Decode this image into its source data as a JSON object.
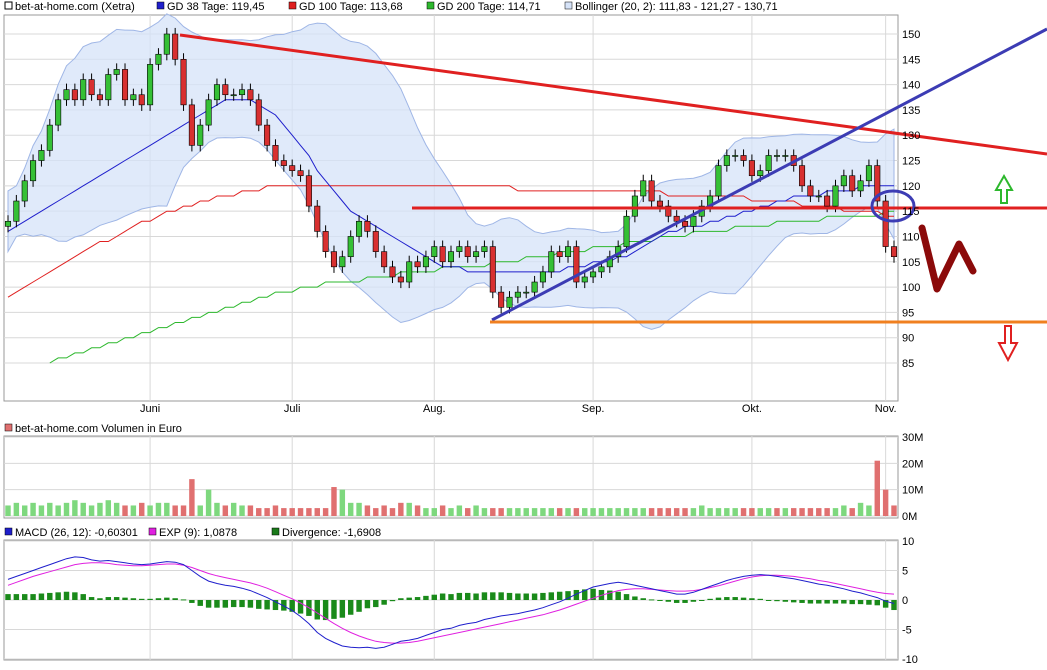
{
  "chart_data": [
    {
      "type": "candlestick",
      "legend": [
        {
          "label": "bet-at-home.com (Xetra)",
          "color": "#000000"
        },
        {
          "label": "GD 38 Tage: 119,45",
          "color": "#1f1fcc"
        },
        {
          "label": "GD 100 Tage: 113,68",
          "color": "#e02020"
        },
        {
          "label": "GD 200 Tage: 114,71",
          "color": "#2db82d"
        },
        {
          "label": "Bollinger (20, 2): 111,83 - 121,27 - 130,71",
          "color": "#9fb6e6"
        }
      ],
      "x_tick_labels": [
        "Juni",
        "Juli",
        "Aug.",
        "Sep.",
        "Okt.",
        "Nov."
      ],
      "y_tick_labels": [
        "85",
        "90",
        "95",
        "100",
        "105",
        "110",
        "115",
        "120",
        "125",
        "130",
        "135",
        "140",
        "145",
        "150"
      ],
      "ylim": [
        81,
        153
      ],
      "grid": true,
      "close": [
        113,
        117,
        121,
        125,
        127,
        132,
        137,
        139,
        137,
        141,
        138,
        137,
        142,
        143,
        137,
        138,
        136,
        144,
        146,
        150,
        145,
        136,
        128,
        132,
        137,
        140,
        138,
        138,
        139,
        137,
        132,
        128,
        125,
        124,
        123,
        122,
        116,
        111,
        107,
        104,
        106,
        110,
        113,
        111,
        107,
        104,
        102,
        101,
        105,
        104,
        106,
        108,
        105,
        107,
        108,
        106,
        107,
        108,
        99,
        96,
        98,
        99,
        99,
        101,
        103,
        107,
        106,
        108,
        101,
        102,
        103,
        104,
        106,
        108,
        114,
        118,
        121,
        117,
        116,
        114,
        113,
        112,
        114,
        116,
        118,
        124,
        126,
        126,
        125,
        122,
        123,
        126,
        126,
        126,
        124,
        120,
        118,
        118,
        116,
        120,
        122,
        119,
        121,
        124,
        117,
        108,
        106
      ],
      "gd38": [
        111,
        112,
        113,
        114,
        115,
        116,
        117,
        118,
        119,
        120,
        121,
        122,
        123,
        124,
        125,
        126,
        127,
        128,
        129,
        130,
        131,
        132,
        133,
        134,
        135,
        136,
        137,
        137,
        137,
        137,
        136,
        135,
        134,
        132,
        130,
        128,
        126,
        123,
        121,
        119,
        117,
        115,
        114,
        113,
        112,
        111,
        110,
        109,
        108,
        107,
        106,
        105,
        104,
        104,
        104,
        103,
        103,
        103,
        103,
        103,
        103,
        103,
        103,
        103,
        103,
        103,
        103,
        104,
        104,
        104,
        105,
        105,
        105,
        106,
        106,
        107,
        108,
        109,
        110,
        111,
        111,
        112,
        112,
        112,
        113,
        113,
        114,
        114,
        115,
        115,
        116,
        116,
        117,
        117,
        118,
        118,
        118,
        118,
        119,
        119,
        119,
        119,
        120,
        120,
        120,
        120,
        120
      ],
      "gd100": [
        98,
        99,
        100,
        101,
        102,
        103,
        104,
        105,
        106,
        107,
        108,
        109,
        109,
        110,
        111,
        112,
        113,
        113,
        114,
        115,
        115,
        116,
        116,
        117,
        117,
        118,
        118,
        118,
        119,
        119,
        119,
        120,
        120,
        120,
        120,
        120,
        120,
        120,
        120,
        120,
        120,
        120,
        120,
        120,
        120,
        120,
        120,
        120,
        120,
        120,
        120,
        120,
        120,
        120,
        120,
        120,
        120,
        120,
        120,
        120,
        120,
        119,
        119,
        119,
        119,
        119,
        119,
        119,
        119,
        119,
        119,
        119,
        119,
        119,
        119,
        119,
        119,
        119,
        119,
        118,
        118,
        118,
        118,
        118,
        118,
        118,
        118,
        118,
        118,
        117,
        117,
        117,
        117,
        117,
        117,
        116,
        116,
        116,
        116,
        116,
        115,
        115,
        115,
        115,
        115,
        114,
        114
      ],
      "gd200": [
        null,
        null,
        null,
        null,
        null,
        85,
        86,
        86,
        87,
        87,
        88,
        88,
        89,
        89,
        90,
        90,
        91,
        91,
        92,
        92,
        93,
        93,
        94,
        94,
        95,
        95,
        96,
        96,
        97,
        97,
        98,
        98,
        99,
        99,
        99,
        100,
        100,
        100,
        101,
        101,
        101,
        101,
        101,
        102,
        102,
        102,
        102,
        103,
        103,
        103,
        103,
        103,
        104,
        104,
        104,
        104,
        104,
        104,
        105,
        105,
        105,
        105,
        106,
        106,
        106,
        106,
        107,
        107,
        107,
        107,
        108,
        108,
        108,
        108,
        109,
        109,
        109,
        109,
        110,
        110,
        110,
        110,
        111,
        111,
        111,
        111,
        111,
        112,
        112,
        112,
        112,
        112,
        113,
        113,
        113,
        113,
        113,
        113,
        114,
        114,
        114,
        114,
        114,
        114,
        114,
        115,
        115
      ],
      "volume_up": [
        1,
        1,
        1,
        1,
        1,
        1,
        1,
        1,
        1,
        1,
        1,
        1,
        1,
        1,
        0,
        1,
        0,
        1,
        1,
        1,
        0,
        0,
        0,
        1,
        1,
        1,
        0,
        1,
        1,
        0,
        0,
        0,
        0,
        0,
        0,
        0,
        0,
        0,
        0,
        0,
        1,
        1,
        1,
        0,
        0,
        0,
        0,
        0,
        1,
        0,
        1,
        1,
        0,
        1,
        1,
        0,
        1,
        1,
        0,
        0,
        1,
        1,
        1,
        1,
        1,
        1,
        0,
        1,
        0,
        1,
        1,
        1,
        1,
        1,
        1,
        1,
        1,
        0,
        0,
        0,
        0,
        0,
        1,
        1,
        1,
        1,
        1,
        1,
        0,
        0,
        1,
        1,
        0,
        1,
        0,
        0,
        0,
        0,
        0,
        1,
        1,
        0,
        1,
        1,
        0,
        0,
        0
      ]
    },
    {
      "type": "bar",
      "title": "bet-at-home.com Volumen in Euro",
      "y_tick_labels": [
        "30M",
        "20M",
        "10M",
        "0M"
      ],
      "ylim": [
        0,
        30
      ],
      "values": [
        4,
        5,
        4,
        5,
        4,
        5,
        4,
        5,
        6,
        5,
        4,
        5,
        6,
        5,
        4,
        4,
        5,
        4,
        5,
        5,
        4,
        4,
        14,
        4,
        10,
        5,
        4,
        5,
        4,
        4,
        3,
        3,
        4,
        3,
        3,
        3,
        3,
        3,
        3,
        11,
        10,
        5,
        5,
        4,
        3,
        4,
        3,
        5,
        5,
        4,
        3,
        3,
        4,
        3,
        4,
        3,
        4,
        3,
        3,
        3,
        3,
        3,
        3,
        3,
        3,
        3,
        3,
        3,
        3,
        3,
        3,
        3,
        3,
        3,
        3,
        3,
        3,
        3,
        3,
        3,
        3,
        3,
        3,
        4,
        3,
        3,
        3,
        3,
        3,
        3,
        3,
        3,
        3,
        3,
        3,
        3,
        3,
        3,
        3,
        3,
        4,
        3,
        5,
        4,
        21,
        10,
        4
      ]
    },
    {
      "type": "line",
      "legend": [
        {
          "label": "MACD (26, 12): -0,60301",
          "color": "#1f1fcc"
        },
        {
          "label": "EXP (9): 1,0878",
          "color": "#e020e0"
        },
        {
          "label": "Divergence: -1,6908",
          "color": "#1a7a1a"
        }
      ],
      "y_tick_labels": [
        "10",
        "5",
        "0",
        "-5",
        "-10"
      ],
      "ylim": [
        -10,
        10
      ],
      "macd": [
        3.5,
        4.0,
        4.5,
        5.0,
        5.5,
        6.0,
        6.5,
        7.0,
        7.3,
        7.2,
        6.8,
        6.6,
        6.7,
        6.5,
        6.3,
        6.1,
        6.0,
        6.1,
        6.3,
        6.5,
        6.4,
        6.0,
        5.0,
        4.0,
        3.2,
        2.8,
        2.5,
        2.3,
        2.0,
        1.6,
        1.0,
        0.4,
        -0.3,
        -1.0,
        -1.8,
        -2.8,
        -4.0,
        -5.5,
        -6.5,
        -7.2,
        -7.8,
        -8.0,
        -8.1,
        -8.0,
        -8.2,
        -8.0,
        -7.5,
        -7.0,
        -6.8,
        -6.5,
        -6.0,
        -5.5,
        -5.0,
        -4.8,
        -4.3,
        -4.0,
        -3.8,
        -3.3,
        -3.0,
        -2.7,
        -2.5,
        -2.3,
        -2.0,
        -1.7,
        -1.3,
        -0.8,
        -0.3,
        0.3,
        1.0,
        1.6,
        2.2,
        2.5,
        2.8,
        3.0,
        2.8,
        2.5,
        2.2,
        1.9,
        1.6,
        1.3,
        1.0,
        1.0,
        1.3,
        1.8,
        2.3,
        2.8,
        3.3,
        3.7,
        4.0,
        4.2,
        4.3,
        4.2,
        4.0,
        3.8,
        3.6,
        3.3,
        3.0,
        2.7,
        2.5,
        2.2,
        1.9,
        1.5,
        1.2,
        0.8,
        0.4,
        -0.2,
        -0.6
      ],
      "exp": [
        2.5,
        3.0,
        3.5,
        4.0,
        4.4,
        4.8,
        5.2,
        5.6,
        6.0,
        6.2,
        6.3,
        6.3,
        6.2,
        6.0,
        5.9,
        5.8,
        5.8,
        5.9,
        6.0,
        6.1,
        6.1,
        5.9,
        5.5,
        5.0,
        4.5,
        4.1,
        3.8,
        3.5,
        3.2,
        2.9,
        2.5,
        2.0,
        1.4,
        0.8,
        0.2,
        -0.5,
        -1.3,
        -2.2,
        -3.1,
        -4.0,
        -4.8,
        -5.5,
        -6.1,
        -6.6,
        -7.0,
        -7.2,
        -7.3,
        -7.3,
        -7.2,
        -7.0,
        -6.7,
        -6.4,
        -6.1,
        -5.8,
        -5.5,
        -5.2,
        -4.9,
        -4.6,
        -4.3,
        -4.0,
        -3.7,
        -3.4,
        -3.1,
        -2.8,
        -2.5,
        -2.1,
        -1.7,
        -1.2,
        -0.7,
        -0.2,
        0.3,
        0.8,
        1.2,
        1.6,
        1.8,
        1.9,
        1.9,
        1.8,
        1.7,
        1.6,
        1.5,
        1.5,
        1.6,
        1.8,
        2.1,
        2.4,
        2.8,
        3.2,
        3.6,
        3.9,
        4.1,
        4.2,
        4.2,
        4.1,
        4.0,
        3.8,
        3.6,
        3.3,
        3.1,
        2.8,
        2.5,
        2.2,
        1.9,
        1.6,
        1.3,
        1.1,
        1.0
      ],
      "divergence": [
        1.0,
        1.0,
        1.0,
        1.0,
        1.1,
        1.2,
        1.3,
        1.4,
        1.3,
        1.0,
        0.5,
        0.3,
        0.5,
        0.5,
        0.4,
        0.3,
        0.2,
        0.2,
        0.3,
        0.4,
        0.3,
        0.1,
        -0.5,
        -1.0,
        -1.3,
        -1.3,
        -1.3,
        -1.2,
        -1.2,
        -1.3,
        -1.5,
        -1.6,
        -1.7,
        -1.8,
        -2.0,
        -2.3,
        -2.7,
        -3.3,
        -3.4,
        -3.2,
        -3.0,
        -2.5,
        -2.0,
        -1.4,
        -1.2,
        -0.8,
        -0.2,
        0.3,
        0.4,
        0.5,
        0.7,
        0.9,
        1.1,
        1.0,
        1.2,
        1.2,
        1.1,
        1.3,
        1.3,
        1.3,
        1.2,
        1.1,
        1.1,
        1.1,
        1.2,
        1.3,
        1.4,
        1.5,
        1.7,
        1.8,
        1.9,
        1.7,
        1.6,
        1.4,
        1.0,
        0.6,
        0.3,
        0.1,
        -0.1,
        -0.3,
        -0.5,
        -0.5,
        -0.3,
        0.0,
        0.2,
        0.4,
        0.5,
        0.5,
        0.4,
        0.3,
        0.2,
        0.0,
        -0.2,
        -0.3,
        -0.4,
        -0.5,
        -0.6,
        -0.6,
        -0.6,
        -0.6,
        -0.6,
        -0.7,
        -0.7,
        -0.8,
        -0.9,
        -1.3,
        -1.7
      ]
    }
  ]
}
